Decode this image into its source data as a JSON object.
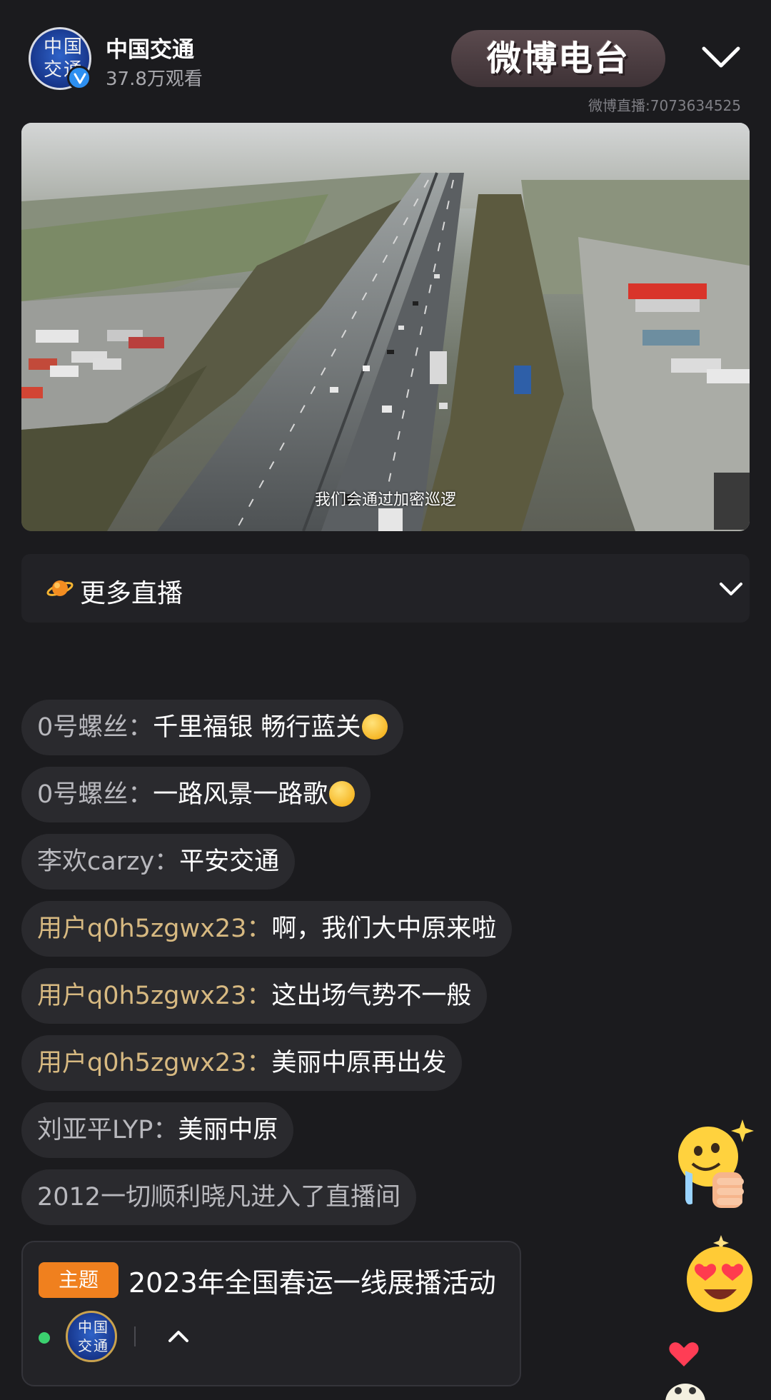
{
  "header": {
    "channel_name": "中国交通",
    "viewers": "37.8万观看",
    "brand_logo_text": "微博电台",
    "live_id": "微博直播:7073634525",
    "avatar_chars": [
      "中",
      "国",
      "交",
      "通"
    ]
  },
  "video": {
    "subtitle": "我们会通过加密巡逻"
  },
  "more_live": {
    "label": "更多直播"
  },
  "chat": [
    {
      "user": "0号螺丝：",
      "message": "千里福银 畅行蓝关",
      "user_color": "gray",
      "emoji": "blush-emoji"
    },
    {
      "user": "0号螺丝：",
      "message": "一路风景一路歌",
      "user_color": "gray",
      "emoji": "blush-emoji"
    },
    {
      "user": "李欢carzy：",
      "message": "平安交通",
      "user_color": "gray"
    },
    {
      "user": "用户q0h5zgwx23：",
      "message": "啊，我们大中原来啦",
      "user_color": "gold"
    },
    {
      "user": "用户q0h5zgwx23：",
      "message": "这出场气势不一般",
      "user_color": "gold"
    },
    {
      "user": "用户q0h5zgwx23：",
      "message": "美丽中原再出发",
      "user_color": "gold"
    },
    {
      "user": "刘亚平LYP：",
      "message": "美丽中原",
      "user_color": "gray"
    },
    {
      "system": "2012一切顺利晓凡进入了直播间"
    }
  ],
  "topic": {
    "tag": "主题",
    "title": "2023年全国春运一线展播活动"
  },
  "colors": {
    "background": "#1b1b1e",
    "gold_username": "#d7b981",
    "topic_tag": "#f0801e",
    "online": "#3bd16f"
  },
  "icons": [
    "verified-icon",
    "chevron-down-icon",
    "planet-icon",
    "chevron-up-icon",
    "thumbs-up-emoji",
    "heart-eyes-emoji",
    "heart-icon"
  ]
}
